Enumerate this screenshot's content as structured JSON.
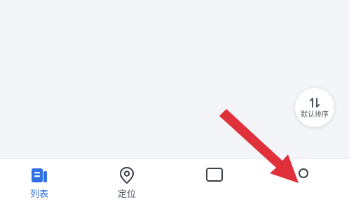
{
  "sort_button": {
    "label": "默认排序",
    "icon": "sort-arrows-icon"
  },
  "bottom_nav": {
    "tabs": [
      {
        "label": "列表",
        "icon": "list-icon",
        "active": true
      },
      {
        "label": "定位",
        "icon": "location-pin-icon",
        "active": false
      }
    ]
  },
  "colors": {
    "background": "#f4f5f9",
    "active_tab": "#2f6fe4",
    "inactive_tab": "#555a63",
    "arrow": "#e0303a"
  }
}
